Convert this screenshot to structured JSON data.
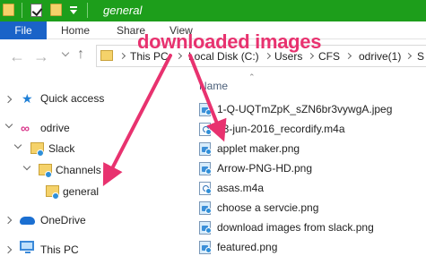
{
  "window": {
    "title": "general"
  },
  "ribbon": {
    "tabs": [
      "File",
      "Home",
      "Share",
      "View"
    ]
  },
  "address": {
    "segments": [
      "This PC",
      "Local Disk (C:)",
      "Users",
      "CFS",
      "odrive(1)",
      "S"
    ]
  },
  "nav": {
    "items": [
      {
        "label": "Quick access",
        "icon": "star-icon"
      },
      {
        "label": "odrive",
        "icon": "odrive-icon"
      },
      {
        "label": "Slack",
        "icon": "folder-icon"
      },
      {
        "label": "Channels",
        "icon": "folder-icon"
      },
      {
        "label": "general",
        "icon": "folder-icon"
      },
      {
        "label": "OneDrive",
        "icon": "cloud-icon"
      },
      {
        "label": "This PC",
        "icon": "pc-icon"
      }
    ]
  },
  "content": {
    "column_header": "Name",
    "files": [
      {
        "name": "1-Q-UQTmZpK_sZN6br3vywgA.jpeg",
        "icon": "image-file-icon"
      },
      {
        "name": "23-jun-2016_recordify.m4a",
        "icon": "media-file-icon"
      },
      {
        "name": "applet maker.png",
        "icon": "image-file-icon"
      },
      {
        "name": "Arrow-PNG-HD.png",
        "icon": "image-file-icon"
      },
      {
        "name": "asas.m4a",
        "icon": "media-file-icon"
      },
      {
        "name": "choose a servcie.png",
        "icon": "image-file-icon"
      },
      {
        "name": "download images from slack.png",
        "icon": "image-file-icon"
      },
      {
        "name": "featured.png",
        "icon": "image-file-icon"
      }
    ]
  },
  "annotation": {
    "label": "downloaded images",
    "color": "#e8326f"
  },
  "colors": {
    "titlebar": "#1d9e1b",
    "file_tab": "#1a63c8"
  }
}
